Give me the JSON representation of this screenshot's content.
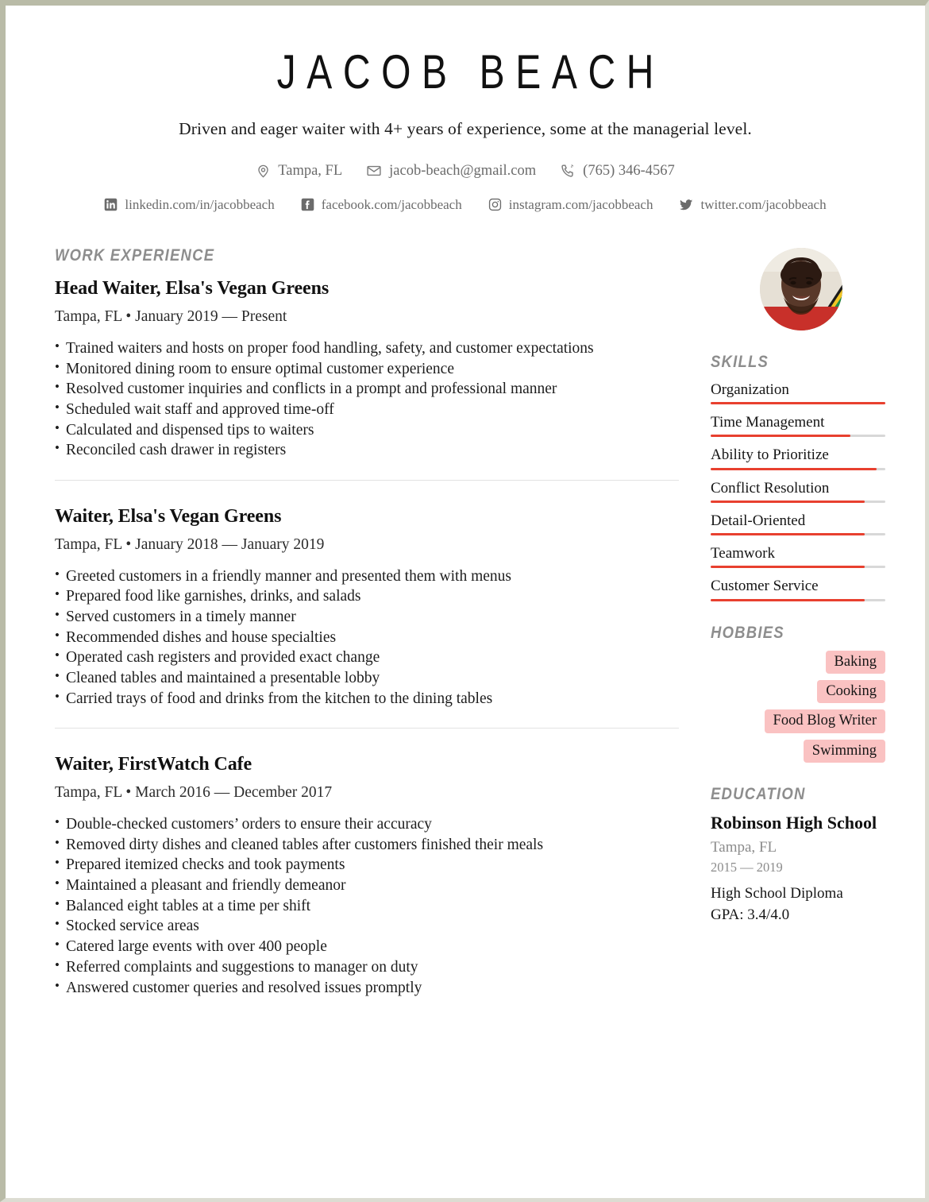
{
  "header": {
    "name": "JACOB BEACH",
    "tagline": "Driven and eager waiter with 4+ years of experience, some at the managerial level.",
    "contacts": [
      {
        "icon": "location-pin-icon",
        "text": "Tampa, FL"
      },
      {
        "icon": "envelope-icon",
        "text": "jacob-beach@gmail.com"
      },
      {
        "icon": "phone-icon",
        "text": "(765) 346-4567"
      }
    ],
    "socials": [
      {
        "icon": "linkedin-icon",
        "text": "linkedin.com/in/jacobbeach"
      },
      {
        "icon": "facebook-icon",
        "text": "facebook.com/jacobbeach"
      },
      {
        "icon": "instagram-icon",
        "text": "instagram.com/jacobbeach"
      },
      {
        "icon": "twitter-icon",
        "text": "twitter.com/jacobbeach"
      }
    ]
  },
  "work": {
    "title": "WORK EXPERIENCE",
    "jobs": [
      {
        "title": "Head Waiter, Elsa's Vegan Greens",
        "meta": "Tampa, FL • January 2019 — Present",
        "bullets": [
          "Trained waiters and hosts on proper food handling, safety, and customer expectations",
          "Monitored dining room to ensure optimal customer experience",
          "Resolved customer inquiries and conflicts in a prompt and professional manner",
          "Scheduled wait staff and approved time-off",
          "Calculated and dispensed tips to waiters",
          "Reconciled cash drawer in registers"
        ]
      },
      {
        "title": "Waiter, Elsa's Vegan Greens",
        "meta": "Tampa, FL • January 2018 — January 2019",
        "bullets": [
          "Greeted customers in a friendly manner and presented them with menus",
          "Prepared food like garnishes, drinks, and salads",
          "Served customers in a timely manner",
          "Recommended dishes and house specialties",
          "Operated cash registers and provided exact change",
          "Cleaned tables and maintained a presentable lobby",
          "Carried trays of food and drinks from the kitchen to the dining tables"
        ]
      },
      {
        "title": "Waiter, FirstWatch Cafe",
        "meta": "Tampa, FL • March 2016 — December 2017",
        "bullets": [
          "Double-checked customers’ orders to ensure their accuracy",
          "Removed dirty dishes and cleaned tables after customers finished their meals",
          "Prepared itemized checks and took payments",
          "Maintained a pleasant and friendly demeanor",
          "Balanced eight tables at a time per shift",
          "Stocked service areas",
          "Catered large events with over 400 people",
          "Referred complaints and suggestions to manager on duty",
          "Answered customer queries and resolved issues promptly"
        ]
      }
    ]
  },
  "skills": {
    "title": "SKILLS",
    "accent_color": "#e8402f",
    "track_color": "#d8d8d8",
    "items": [
      {
        "label": "Organization",
        "level": 100
      },
      {
        "label": "Time Management",
        "level": 80
      },
      {
        "label": "Ability to Prioritize",
        "level": 95
      },
      {
        "label": "Conflict Resolution",
        "level": 88
      },
      {
        "label": "Detail-Oriented",
        "level": 88
      },
      {
        "label": "Teamwork",
        "level": 88
      },
      {
        "label": "Customer Service",
        "level": 88
      }
    ]
  },
  "hobbies": {
    "title": "HOBBIES",
    "tag_color": "#fac2c2",
    "items": [
      "Baking",
      "Cooking",
      "Food Blog Writer",
      "Swimming"
    ]
  },
  "education": {
    "title": "EDUCATION",
    "school": "Robinson High School",
    "location": "Tampa, FL",
    "years": "2015 — 2019",
    "degree": "High School Diploma",
    "gpa": "GPA: 3.4/4.0"
  },
  "avatar": {
    "alt": "profile-photo"
  }
}
